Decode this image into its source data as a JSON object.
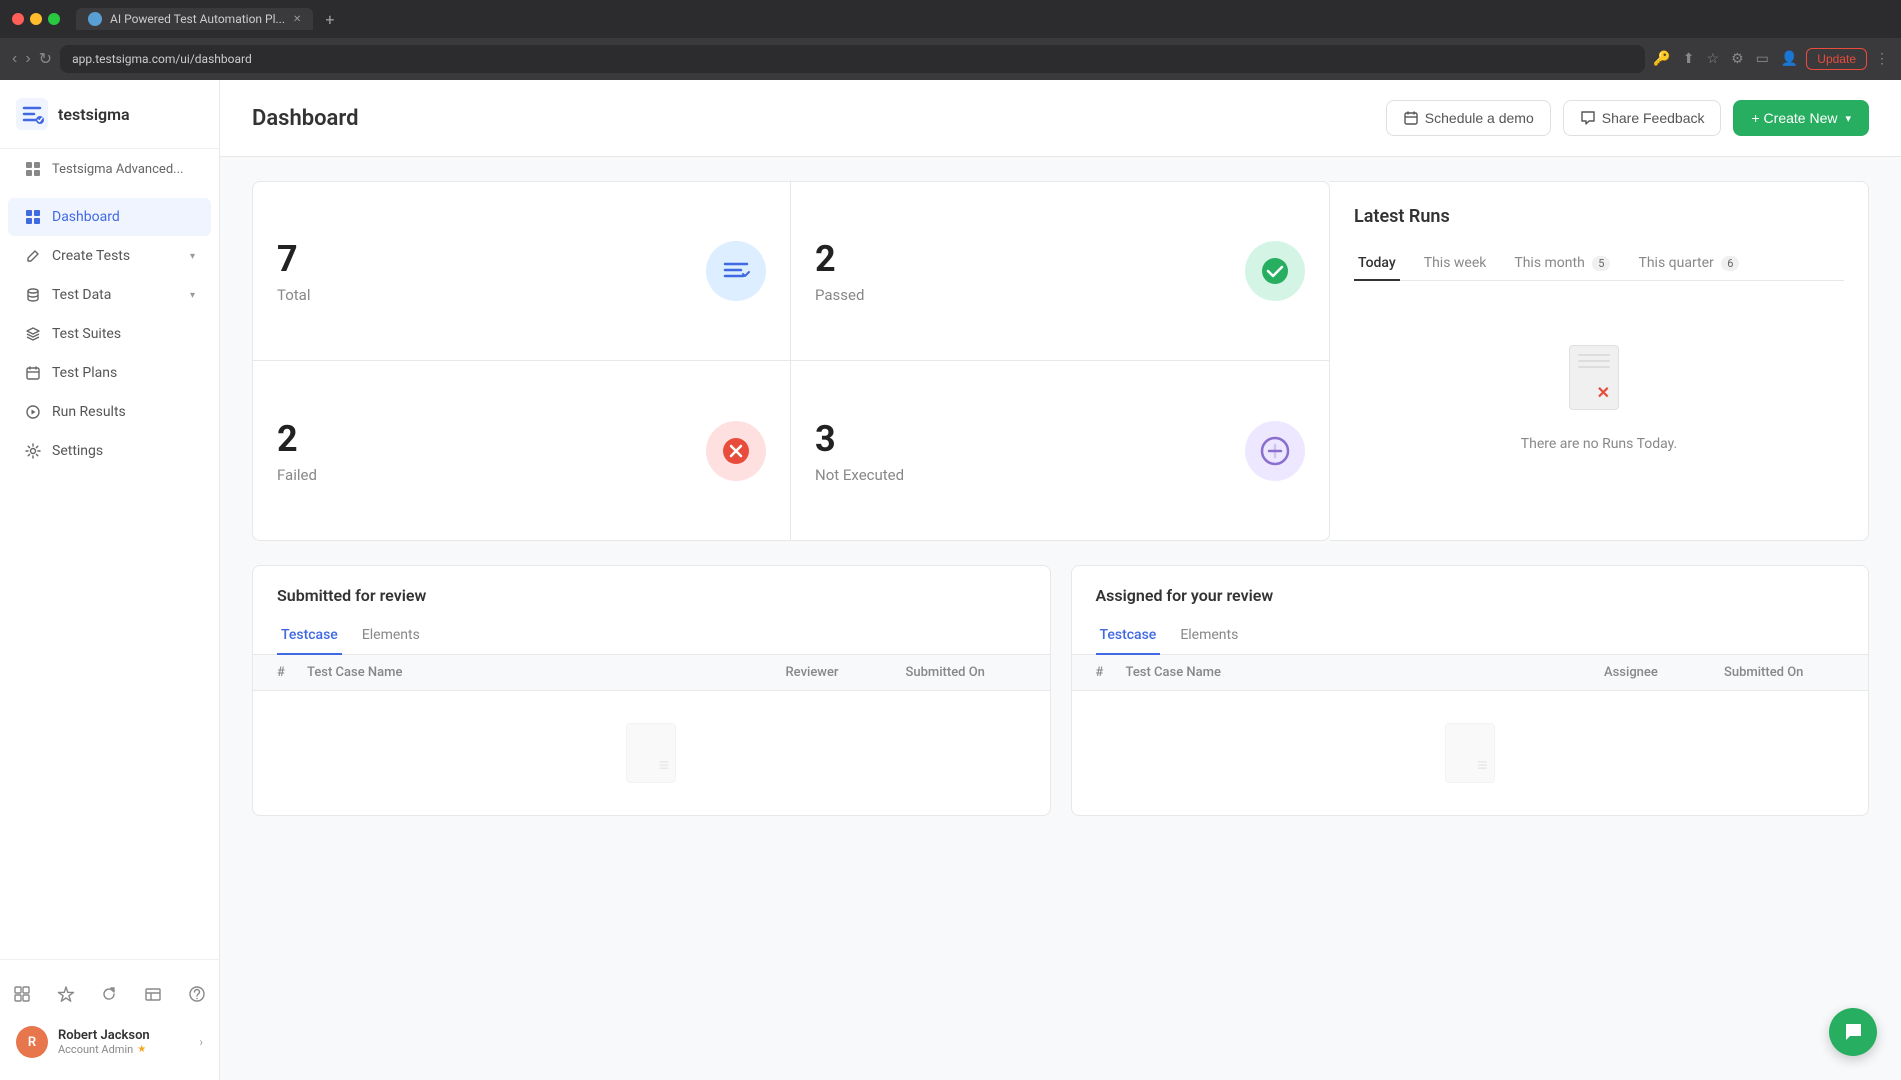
{
  "browser": {
    "tab_title": "AI Powered Test Automation Pl...",
    "url": "app.testsigma.com/ui/dashboard",
    "update_label": "Update"
  },
  "app": {
    "logo_text": "testsigma",
    "workspace_label": "Testsigma Advanced..."
  },
  "sidebar": {
    "nav_items": [
      {
        "id": "dashboard",
        "label": "Dashboard",
        "icon": "grid",
        "active": true
      },
      {
        "id": "create-tests",
        "label": "Create Tests",
        "icon": "pencil",
        "has_chevron": true
      },
      {
        "id": "test-data",
        "label": "Test Data",
        "icon": "database",
        "has_chevron": true
      },
      {
        "id": "test-suites",
        "label": "Test Suites",
        "icon": "layers"
      },
      {
        "id": "test-plans",
        "label": "Test Plans",
        "icon": "calendar"
      },
      {
        "id": "run-results",
        "label": "Run Results",
        "icon": "play"
      },
      {
        "id": "settings",
        "label": "Settings",
        "icon": "gear"
      }
    ],
    "user": {
      "name": "Robert Jackson",
      "role": "Account Admin",
      "initials": "R"
    }
  },
  "header": {
    "title": "Dashboard",
    "schedule_demo_label": "Schedule a demo",
    "share_feedback_label": "Share Feedback",
    "create_new_label": "+ Create New"
  },
  "stats": {
    "total": {
      "number": "7",
      "label": "Total"
    },
    "passed": {
      "number": "2",
      "label": "Passed"
    },
    "failed": {
      "number": "2",
      "label": "Failed"
    },
    "not_executed": {
      "number": "3",
      "label": "Not Executed"
    }
  },
  "latest_runs": {
    "title": "Latest Runs",
    "tabs": [
      {
        "label": "Today",
        "active": true,
        "badge": null
      },
      {
        "label": "This week",
        "active": false,
        "badge": null
      },
      {
        "label": "This month",
        "active": false,
        "badge": "5"
      },
      {
        "label": "This quarter",
        "active": false,
        "badge": "6"
      }
    ],
    "empty_text": "There are no Runs Today."
  },
  "submitted_for_review": {
    "title": "Submitted for review",
    "tabs": [
      {
        "label": "Testcase",
        "active": true
      },
      {
        "label": "Elements",
        "active": false
      }
    ],
    "columns": [
      "#",
      "Test Case Name",
      "Reviewer",
      "Submitted On"
    ]
  },
  "assigned_for_review": {
    "title": "Assigned for your review",
    "tabs": [
      {
        "label": "Testcase",
        "active": true
      },
      {
        "label": "Elements",
        "active": false
      }
    ],
    "columns": [
      "#",
      "Test Case Name",
      "Assignee",
      "Submitted On"
    ]
  }
}
